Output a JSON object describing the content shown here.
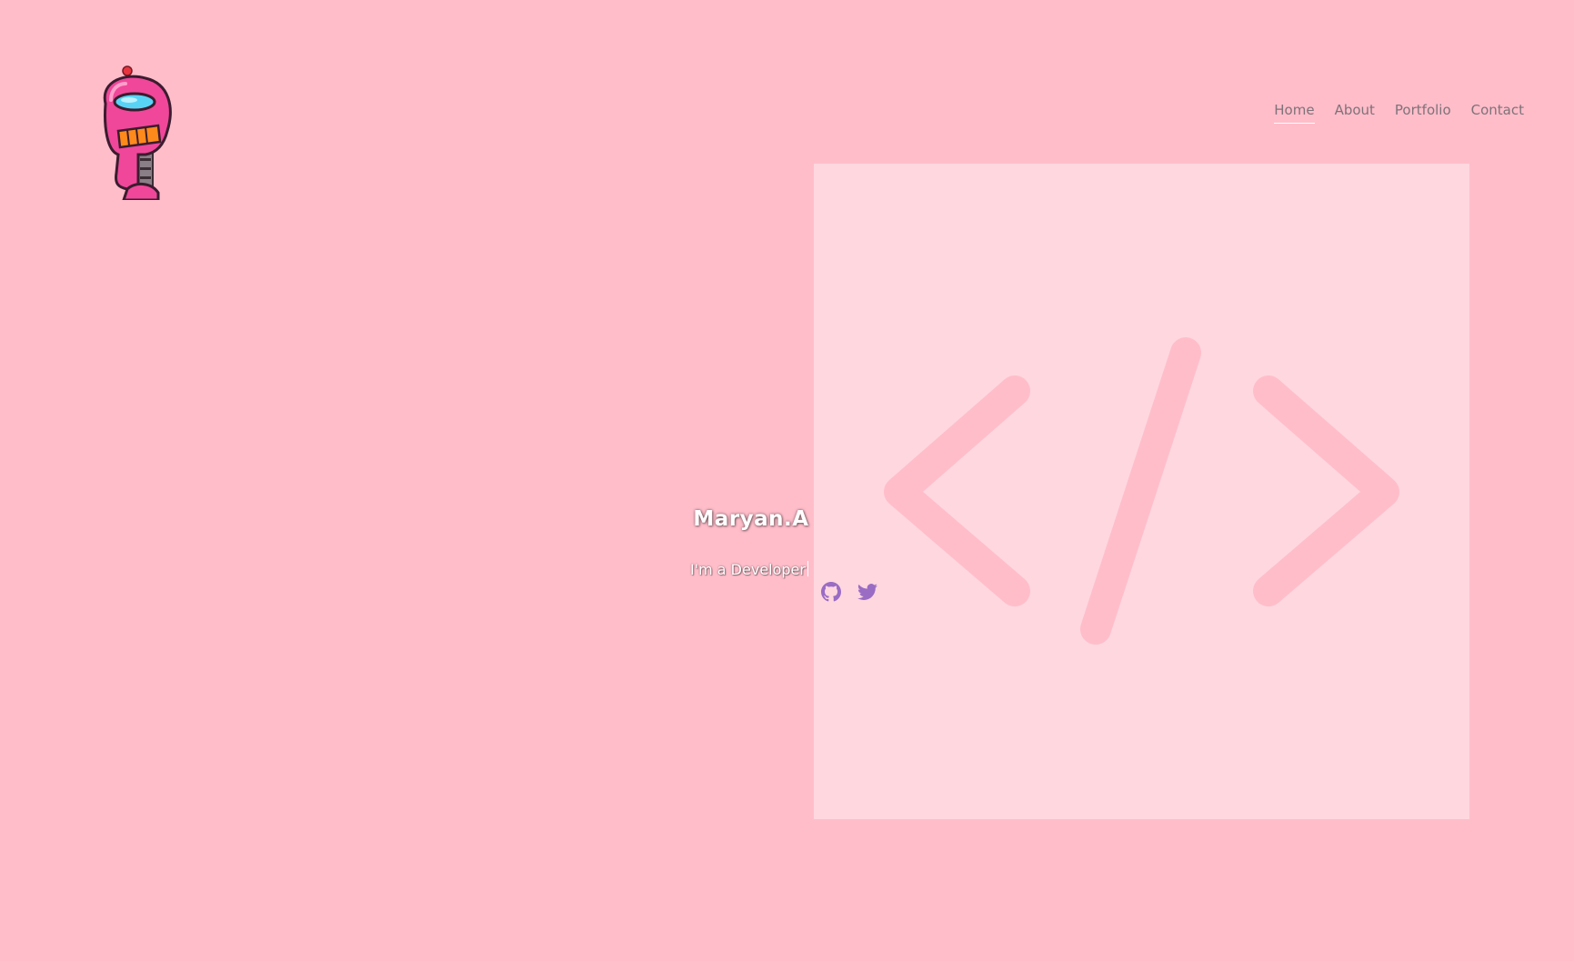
{
  "nav": {
    "items": [
      {
        "label": "Home",
        "active": true
      },
      {
        "label": "About",
        "active": false
      },
      {
        "label": "Portfolio",
        "active": false
      },
      {
        "label": "Contact",
        "active": false
      }
    ]
  },
  "hero": {
    "name": "Maryan.A",
    "subtitle": "I'm a Developer"
  },
  "icons": {
    "logo": "robot-logo-icon",
    "code": "code-brackets-icon",
    "social": [
      "github-icon",
      "twitter-icon"
    ]
  },
  "colors": {
    "background": "#ffbdca",
    "panel": "#fed7de",
    "accent_pink": "#ff4fa0",
    "social_icons": "#9a6cc4",
    "nav_text": "#7e7378"
  }
}
